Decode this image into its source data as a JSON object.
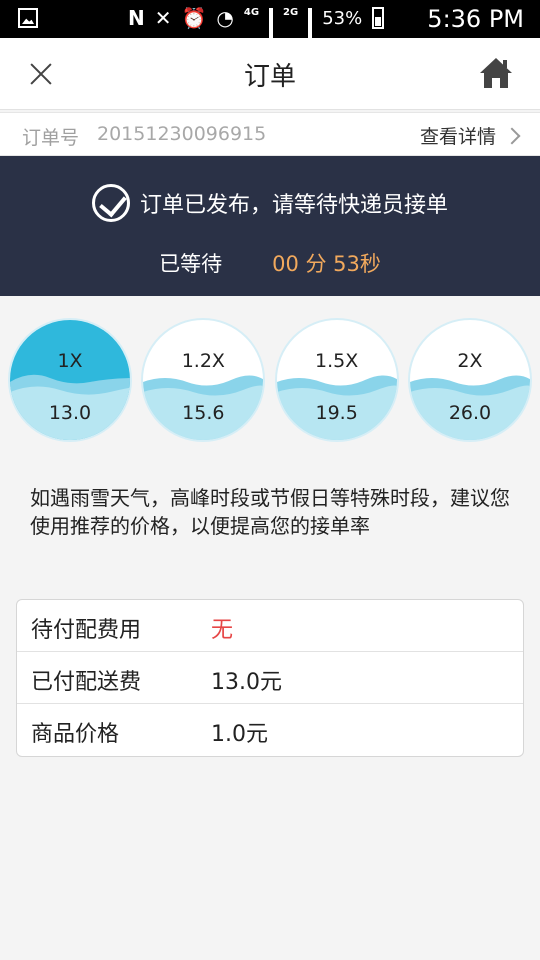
{
  "status_bar": {
    "net_label": "4G",
    "net_label2": "4G",
    "net_label3": "2G",
    "battery": "53%",
    "time": "5:36 PM"
  },
  "header": {
    "title": "订单",
    "close_icon": "close-icon",
    "home_icon": "home-icon"
  },
  "order": {
    "number_label": "订单号",
    "number": "20151230096915",
    "details_label": "查看详情"
  },
  "banner": {
    "message": "订单已发布，请等待快递员接单",
    "waited_label": "已等待",
    "waited_time": "00 分 53秒"
  },
  "price_options": [
    {
      "multiplier": "1X",
      "price": "13.0",
      "level": 0.62
    },
    {
      "multiplier": "1.2X",
      "price": "15.6",
      "level": 0.45
    },
    {
      "multiplier": "1.5X",
      "price": "19.5",
      "level": 0.45
    },
    {
      "multiplier": "2X",
      "price": "26.0",
      "level": 0.45
    }
  ],
  "note": "如遇雨雪天气，高峰时段或节假日等特殊时段，建议您使用推荐的价格，以便提高您的接单率",
  "fees": [
    {
      "label": "待付配费用",
      "value": "无",
      "highlight": true
    },
    {
      "label": "已付配送费",
      "value": "13.0元",
      "highlight": false
    },
    {
      "label": "商品价格",
      "value": "1.0元",
      "highlight": false
    }
  ],
  "colors": {
    "banner_bg": "#2a3146",
    "accent_orange": "#f1a95d",
    "wave_dark": "#2fb8dc",
    "wave_light": "#a8e0ef",
    "red": "#e64646"
  }
}
